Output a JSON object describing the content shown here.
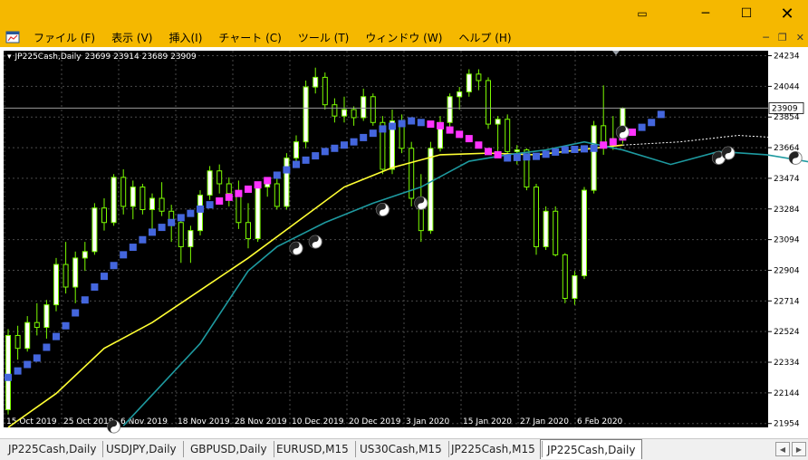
{
  "menu": {
    "items": [
      "ファイル (F)",
      "表示 (V)",
      "挿入(I)",
      "チャート (C)",
      "ツール (T)",
      "ウィンドウ (W)",
      "ヘルプ (H)"
    ]
  },
  "chart": {
    "header": {
      "symbol": "JP225Cash,Daily",
      "ohlc": "23699 23914 23689 23909"
    },
    "current_price": "23909",
    "colors": {
      "background": "#000000",
      "grid": "#4a4a4a",
      "bull": "#7cfc00",
      "bear": "#ffffff",
      "ma_fast": "#ffff33",
      "ma_slow": "#1e9aa0",
      "trend_up": "#4466dd",
      "trend_down": "#ff33ff"
    }
  },
  "chart_data": {
    "type": "candlestick",
    "title": "",
    "y_ticks": [
      24234,
      24044,
      23854,
      23664,
      23474,
      23284,
      23094,
      22904,
      22714,
      22524,
      22334,
      22144,
      21954
    ],
    "x_ticks": [
      "15 Oct 2019",
      "25 Oct 2019",
      "6 Nov 2019",
      "18 Nov 2019",
      "28 Nov 2019",
      "10 Dec 2019",
      "20 Dec 2019",
      "3 Jan 2020",
      "15 Jan 2020",
      "27 Jan 2020",
      "6 Feb 2020"
    ],
    "ylim": [
      21930,
      24265
    ],
    "candles": [
      [
        22040,
        22540,
        22010,
        22500
      ],
      [
        22500,
        22560,
        22350,
        22420
      ],
      [
        22420,
        22620,
        22400,
        22580
      ],
      [
        22580,
        22700,
        22500,
        22550
      ],
      [
        22550,
        22720,
        22480,
        22690
      ],
      [
        22690,
        22980,
        22650,
        22940
      ],
      [
        22940,
        23080,
        22760,
        22800
      ],
      [
        22800,
        23020,
        22700,
        22980
      ],
      [
        22980,
        23080,
        22900,
        23020
      ],
      [
        23020,
        23320,
        23000,
        23290
      ],
      [
        23290,
        23350,
        23150,
        23200
      ],
      [
        23200,
        23500,
        23180,
        23480
      ],
      [
        23480,
        23530,
        23250,
        23300
      ],
      [
        23300,
        23460,
        23220,
        23420
      ],
      [
        23420,
        23440,
        23250,
        23280
      ],
      [
        23280,
        23380,
        23130,
        23350
      ],
      [
        23350,
        23450,
        23240,
        23270
      ],
      [
        23270,
        23310,
        23080,
        23200
      ],
      [
        23200,
        23250,
        22950,
        23050
      ],
      [
        23050,
        23180,
        22950,
        23150
      ],
      [
        23150,
        23400,
        23120,
        23370
      ],
      [
        23370,
        23550,
        23340,
        23520
      ],
      [
        23520,
        23560,
        23380,
        23440
      ],
      [
        23440,
        23480,
        23300,
        23380
      ],
      [
        23380,
        23460,
        23160,
        23200
      ],
      [
        23200,
        23320,
        23040,
        23100
      ],
      [
        23100,
        23440,
        23080,
        23420
      ],
      [
        23420,
        23470,
        23360,
        23440
      ],
      [
        23440,
        23480,
        23280,
        23300
      ],
      [
        23300,
        23630,
        23280,
        23600
      ],
      [
        23600,
        23740,
        23560,
        23700
      ],
      [
        23700,
        24080,
        23660,
        24040
      ],
      [
        24040,
        24160,
        24000,
        24100
      ],
      [
        24100,
        24130,
        23900,
        23930
      ],
      [
        23930,
        23970,
        23820,
        23860
      ],
      [
        23860,
        23980,
        23820,
        23900
      ],
      [
        23900,
        23920,
        23800,
        23850
      ],
      [
        23850,
        24030,
        23830,
        23980
      ],
      [
        23980,
        24000,
        23800,
        23820
      ],
      [
        23820,
        23860,
        23500,
        23530
      ],
      [
        23530,
        23900,
        23500,
        23830
      ],
      [
        23830,
        23870,
        23630,
        23660
      ],
      [
        23660,
        23700,
        23300,
        23350
      ],
      [
        23350,
        23500,
        23080,
        23150
      ],
      [
        23150,
        23700,
        23130,
        23660
      ],
      [
        23660,
        23860,
        23640,
        23820
      ],
      [
        23820,
        24000,
        23780,
        23980
      ],
      [
        23980,
        24040,
        23900,
        24010
      ],
      [
        24010,
        24150,
        23980,
        24120
      ],
      [
        24120,
        24150,
        24020,
        24080
      ],
      [
        24080,
        24100,
        23780,
        23810
      ],
      [
        23810,
        23860,
        23620,
        23840
      ],
      [
        23840,
        23870,
        23600,
        23640
      ],
      [
        23640,
        23680,
        23560,
        23650
      ],
      [
        23650,
        23660,
        23400,
        23420
      ],
      [
        23420,
        23440,
        23000,
        23050
      ],
      [
        23050,
        23300,
        23030,
        23270
      ],
      [
        23270,
        23300,
        22990,
        23000
      ],
      [
        23000,
        23010,
        22700,
        22730
      ],
      [
        22730,
        22900,
        22690,
        22870
      ],
      [
        22870,
        23420,
        22850,
        23400
      ],
      [
        23400,
        23830,
        23380,
        23800
      ],
      [
        23800,
        24050,
        23620,
        23680
      ],
      [
        23680,
        23860,
        23650,
        23720
      ],
      [
        23720,
        23914,
        23689,
        23909
      ]
    ],
    "ma_fast": [
      [
        0,
        21930
      ],
      [
        5,
        22140
      ],
      [
        10,
        22420
      ],
      [
        15,
        22580
      ],
      [
        20,
        22780
      ],
      [
        25,
        22980
      ],
      [
        30,
        23200
      ],
      [
        35,
        23420
      ],
      [
        40,
        23540
      ],
      [
        45,
        23620
      ],
      [
        50,
        23630
      ],
      [
        55,
        23620
      ],
      [
        64,
        23680
      ]
    ],
    "ma_slow": [
      [
        12,
        21940
      ],
      [
        20,
        22450
      ],
      [
        25,
        22900
      ],
      [
        28,
        23050
      ],
      [
        33,
        23200
      ],
      [
        38,
        23320
      ],
      [
        43,
        23420
      ],
      [
        48,
        23580
      ],
      [
        52,
        23620
      ],
      [
        56,
        23650
      ],
      [
        60,
        23700
      ],
      [
        64,
        23650
      ],
      [
        69,
        23560
      ],
      [
        74,
        23640
      ],
      [
        79,
        23620
      ],
      [
        84,
        23570
      ]
    ],
    "ma_projection": [
      [
        64,
        23680
      ],
      [
        70,
        23700
      ],
      [
        76,
        23740
      ],
      [
        82,
        23720
      ]
    ],
    "trend": [
      [
        0,
        22240
      ],
      [
        3,
        22360
      ],
      [
        6,
        22560
      ],
      [
        9,
        22800
      ],
      [
        12,
        23000
      ],
      [
        15,
        23140
      ],
      [
        18,
        23230
      ],
      [
        21,
        23310
      ],
      [
        24,
        23380
      ],
      [
        27,
        23460
      ],
      [
        30,
        23560
      ],
      [
        33,
        23640
      ],
      [
        36,
        23700
      ],
      [
        39,
        23780
      ],
      [
        42,
        23830
      ],
      [
        45,
        23800
      ],
      [
        48,
        23720
      ],
      [
        50,
        23640
      ],
      [
        52,
        23600
      ],
      [
        55,
        23610
      ],
      [
        58,
        23650
      ],
      [
        61,
        23660
      ],
      [
        63,
        23700
      ],
      [
        65,
        23760
      ],
      [
        67,
        23820
      ],
      [
        68,
        23870
      ]
    ],
    "trend_down_segments": [
      [
        22,
        27
      ],
      [
        44,
        51
      ],
      [
        62,
        65
      ]
    ],
    "signals": [
      [
        11,
        21935
      ],
      [
        30,
        23040
      ],
      [
        32,
        23080
      ],
      [
        39,
        23280
      ],
      [
        43,
        23320
      ],
      [
        64,
        23760
      ],
      [
        74,
        23600
      ],
      [
        75,
        23630
      ],
      [
        82,
        23600
      ]
    ]
  },
  "tabs": [
    {
      "label": "JP225Cash,Daily",
      "active": false
    },
    {
      "label": "USDJPY,Daily",
      "active": false
    },
    {
      "label": "GBPUSD,Daily",
      "active": false
    },
    {
      "label": "EURUSD,M15",
      "active": false
    },
    {
      "label": "US30Cash,M15",
      "active": false
    },
    {
      "label": "JP225Cash,M15",
      "active": false
    },
    {
      "label": "JP225Cash,Daily",
      "active": true
    }
  ]
}
